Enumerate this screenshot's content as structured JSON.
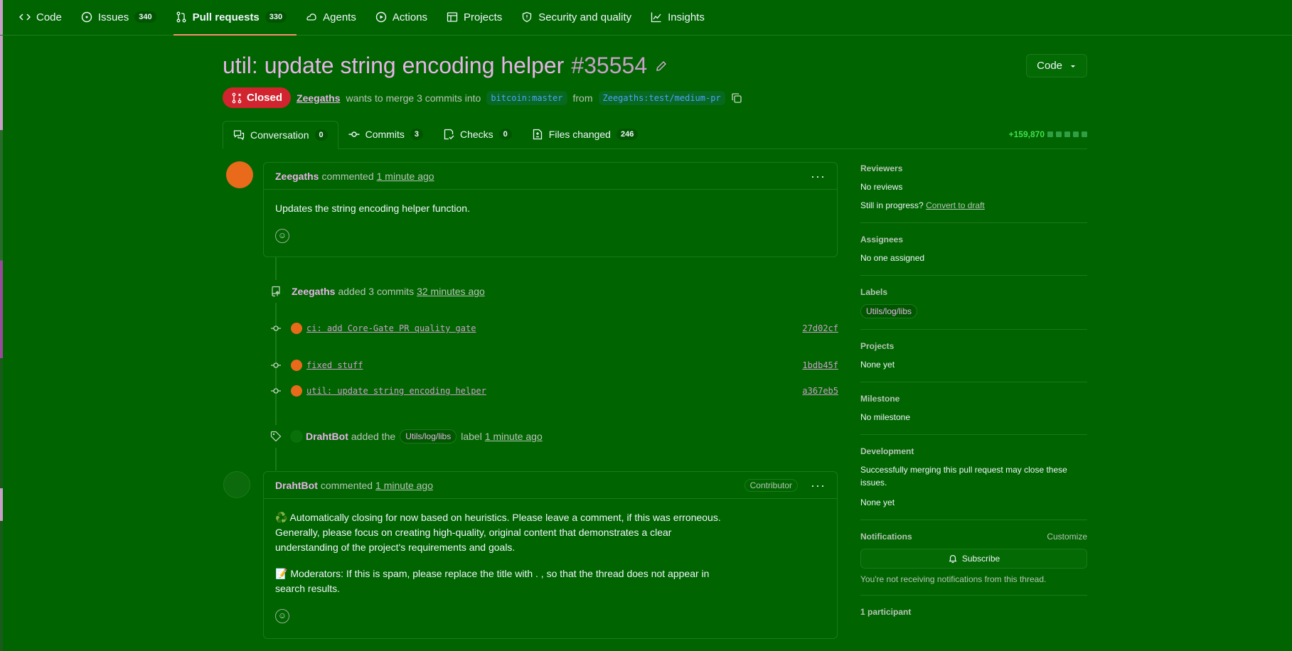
{
  "repo_nav": {
    "items": [
      {
        "label": "Code",
        "count": ""
      },
      {
        "label": "Issues",
        "count": "340"
      },
      {
        "label": "Pull requests",
        "count": "330"
      },
      {
        "label": "Agents",
        "count": ""
      },
      {
        "label": "Actions",
        "count": ""
      },
      {
        "label": "Projects",
        "count": ""
      },
      {
        "label": "Security and quality",
        "count": ""
      },
      {
        "label": "Insights",
        "count": ""
      }
    ],
    "active": "Pull requests"
  },
  "pr": {
    "title": "util: update string encoding helper",
    "number": "#35554",
    "code_button": "Code",
    "state": "Closed",
    "author": "Zeegaths",
    "merge_text": "wants to merge 3 commits into",
    "base_branch": "bitcoin:master",
    "from_text": "from",
    "head_branch": "Zeegaths:test/medium-pr"
  },
  "tabs": [
    {
      "label": "Conversation",
      "count": "0"
    },
    {
      "label": "Commits",
      "count": "3"
    },
    {
      "label": "Checks",
      "count": "0"
    },
    {
      "label": "Files changed",
      "count": "246"
    }
  ],
  "diffstat": "+159,870",
  "timeline": {
    "first_comment": {
      "author": "Zeegaths",
      "action": "commented",
      "time": "1 minute ago",
      "body": "Updates the string encoding helper function."
    },
    "commits_event": {
      "author": "Zeegaths",
      "action": "added 3 commits",
      "time": "32 minutes ago"
    },
    "commits": [
      {
        "message": "ci: add Core-Gate PR quality gate",
        "sha": "27d02cf"
      },
      {
        "message": "fixed stuff",
        "sha": "1bdb45f"
      },
      {
        "message": "util: update string encoding helper",
        "sha": "a367eb5"
      }
    ],
    "label_event": {
      "author": "DrahtBot",
      "action": "added the",
      "label": "Utils/log/libs",
      "suffix": "label",
      "time": "1 minute ago"
    },
    "bot_comment": {
      "author": "DrahtBot",
      "action": "commented",
      "time": "1 minute ago",
      "role": "Contributor",
      "para1": "♻️ Automatically closing for now based on heuristics. Please leave a comment, if this was erroneous. Generally, please focus on creating high-quality, original content that demonstrates a clear understanding of the project's requirements and goals.",
      "para2": "📝 Moderators: If this is spam, please replace the title with  . , so that the thread does not appear in search results."
    }
  },
  "sidebar": {
    "reviewers": {
      "heading": "Reviewers",
      "value": "No reviews",
      "progress_q": "Still in progress?",
      "progress_link": "Convert to draft"
    },
    "assignees": {
      "heading": "Assignees",
      "value": "No one assigned"
    },
    "labels": {
      "heading": "Labels",
      "value": "Utils/log/libs"
    },
    "projects": {
      "heading": "Projects",
      "value": "None yet"
    },
    "milestone": {
      "heading": "Milestone",
      "value": "No milestone"
    },
    "development": {
      "heading": "Development",
      "text": "Successfully merging this pull request may close these issues.",
      "value": "None yet"
    },
    "notifications": {
      "heading": "Notifications",
      "customize": "Customize",
      "button": "Subscribe",
      "note": "You're not receiving notifications from this thread."
    },
    "participants": {
      "heading": "1 participant"
    }
  },
  "colors": {
    "background": "#006400",
    "closed": "#d1242f",
    "accent_pink": "#e8b4e8",
    "diff_add": "#3fe04f"
  }
}
